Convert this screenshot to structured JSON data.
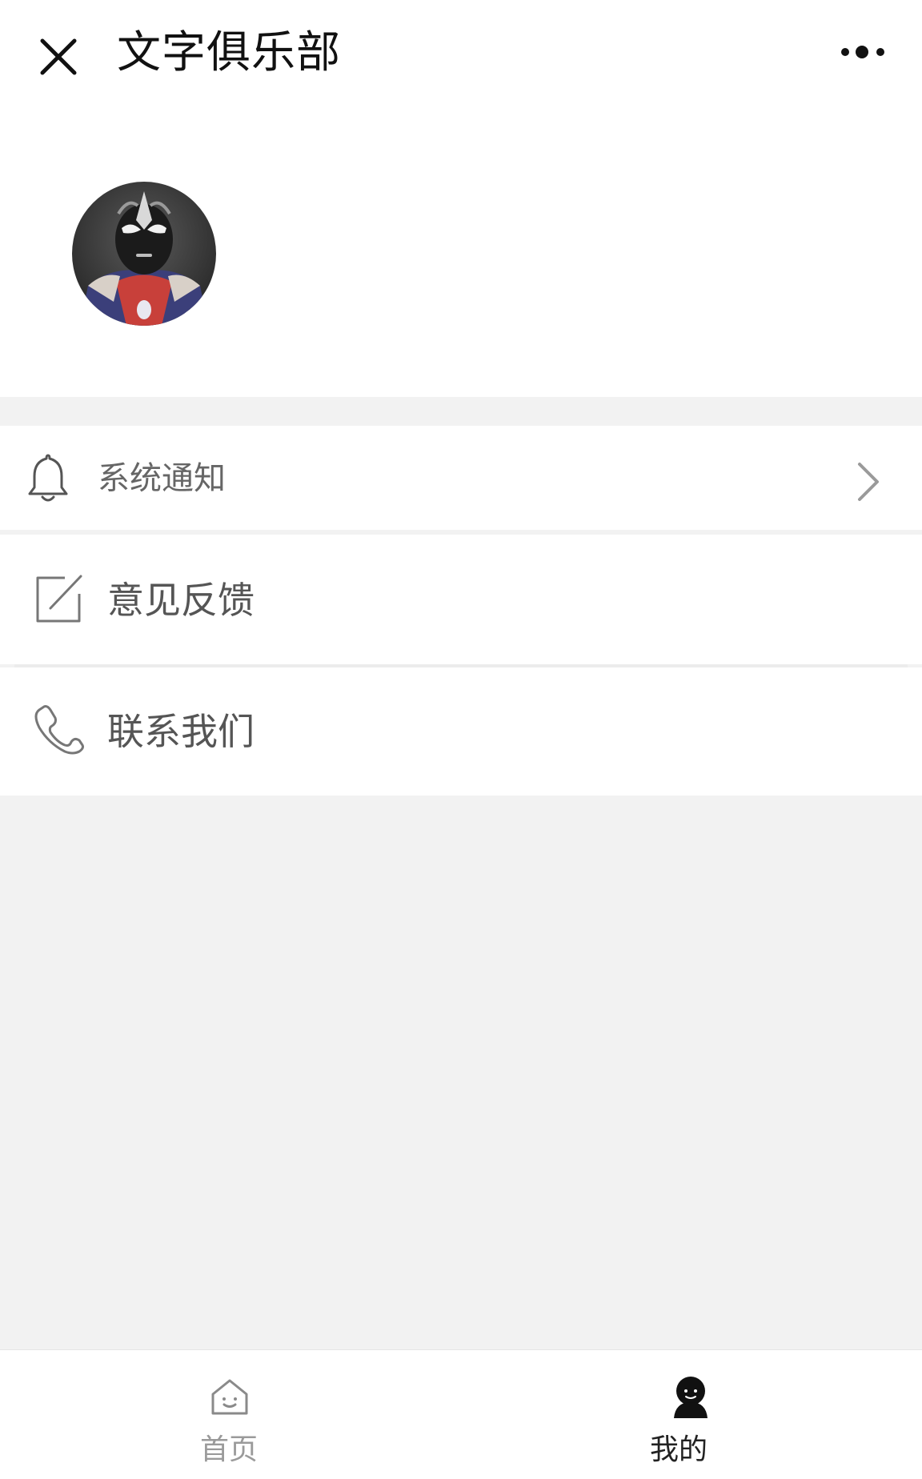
{
  "header": {
    "title": "文字俱乐部",
    "close_icon": "close-icon",
    "more_icon": "more-dots-icon"
  },
  "profile": {
    "avatar_icon": "avatar"
  },
  "menu": {
    "items": [
      {
        "label": "系统通知",
        "icon": "bell-icon",
        "has_chevron": true
      },
      {
        "label": "意见反馈",
        "icon": "edit-icon"
      },
      {
        "label": "联系我们",
        "icon": "phone-icon"
      }
    ]
  },
  "tabbar": {
    "tabs": [
      {
        "label": "首页",
        "icon": "home-icon",
        "active": false
      },
      {
        "label": "我的",
        "icon": "user-icon",
        "active": true
      }
    ]
  },
  "colors": {
    "background": "#f2f2f2",
    "surface": "#ffffff",
    "active_tab": "#222222",
    "inactive_tab": "#9a9a9a"
  }
}
